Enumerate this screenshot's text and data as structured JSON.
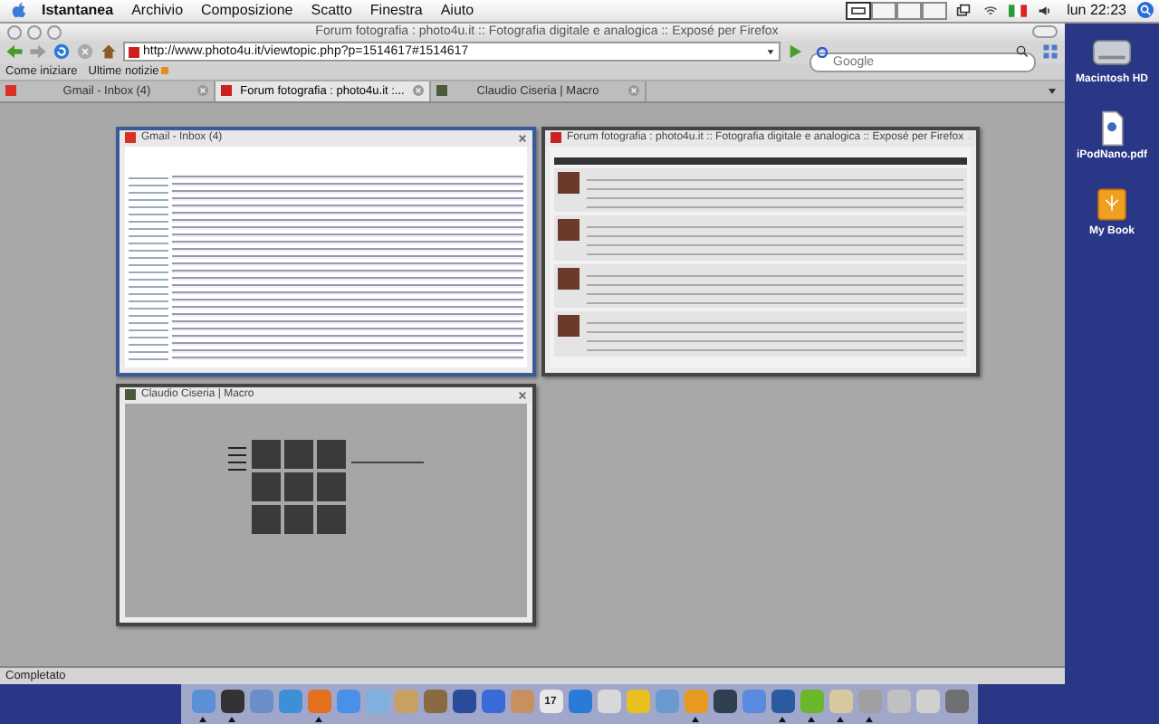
{
  "menu_bar": {
    "app": "Istantanea",
    "items": [
      "Archivio",
      "Composizione",
      "Scatto",
      "Finestra",
      "Aiuto"
    ],
    "spaces": [
      {
        "selected": true
      },
      {
        "selected": false
      },
      {
        "selected": false
      },
      {
        "selected": false
      }
    ],
    "clock": "lun 22:23"
  },
  "window": {
    "title": "Forum fotografia : photo4u.it :: Fotografia digitale e analogica :: Exposé per Firefox",
    "url": "http://www.photo4u.it/viewtopic.php?p=1514617#1514617",
    "search": {
      "placeholder": "Google"
    },
    "bookmarks": [
      "Come iniziare",
      "Ultime notizie"
    ],
    "tabs": [
      {
        "label": "Gmail - Inbox (4)",
        "selected": false,
        "kind": "gmail"
      },
      {
        "label": "Forum fotografia : photo4u.it :...",
        "selected": true,
        "kind": "forum"
      },
      {
        "label": "Claudio Ciseria | Macro",
        "selected": false,
        "kind": "gallery"
      }
    ],
    "thumbnails": [
      {
        "title": "Gmail - Inbox (4)",
        "kind": "gmail",
        "selected": true
      },
      {
        "title": "Forum fotografia : photo4u.it :: Fotografia digitale e analogica :: Exposé per Firefox",
        "kind": "forum",
        "selected": false
      },
      {
        "title": "Claudio Ciseria | Macro",
        "kind": "gallery",
        "selected": false
      }
    ],
    "status": "Completato"
  },
  "desktop_icons": [
    {
      "label": "Macintosh HD",
      "kind": "disk"
    },
    {
      "label": "iPodNano.pdf",
      "kind": "document"
    },
    {
      "label": "My Book",
      "kind": "drive"
    }
  ],
  "dock": [
    {
      "running": true
    },
    {
      "running": true
    },
    {
      "running": false
    },
    {
      "running": false
    },
    {
      "running": true
    },
    {
      "running": false
    },
    {
      "running": false
    },
    {
      "running": false
    },
    {
      "running": false
    },
    {
      "running": false
    },
    {
      "running": false
    },
    {
      "running": false
    },
    {
      "running": false,
      "date": "17"
    },
    {
      "running": false
    },
    {
      "running": false
    },
    {
      "running": false
    },
    {
      "running": false
    },
    {
      "running": true
    },
    {
      "running": false
    },
    {
      "running": false
    },
    {
      "running": true
    },
    {
      "running": true
    },
    {
      "running": true
    },
    {
      "running": true
    },
    {
      "running": false
    },
    {
      "running": false
    },
    {
      "running": false
    }
  ]
}
